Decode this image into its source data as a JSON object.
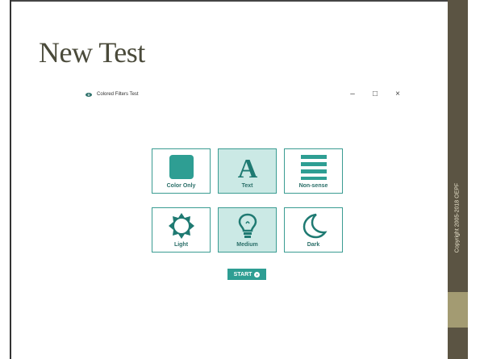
{
  "slide": {
    "title": "New Test",
    "sidebar_text": "Copyright 2005-2018 OEPF"
  },
  "window": {
    "title": "Colored Filters Test",
    "controls": [
      "–",
      "□",
      "×"
    ]
  },
  "tiles": [
    {
      "label": "Color Only",
      "icon": "square-icon",
      "selected": false
    },
    {
      "label": "Text",
      "icon": "letter-a-icon",
      "selected": true
    },
    {
      "label": "Non-sense",
      "icon": "lines-icon",
      "selected": false
    },
    {
      "label": "Light",
      "icon": "sun-icon",
      "selected": false
    },
    {
      "label": "Medium",
      "icon": "lightbulb-icon",
      "selected": true
    },
    {
      "label": "Dark",
      "icon": "moon-icon",
      "selected": false
    }
  ],
  "start_button": {
    "label": "START"
  },
  "colors": {
    "accent": "#2e9e93",
    "tile_border": "#3a9c92",
    "selected_bg": "#cbe9e5",
    "sidebar": "#5b5443",
    "sidebar_block": "#a39b72"
  }
}
